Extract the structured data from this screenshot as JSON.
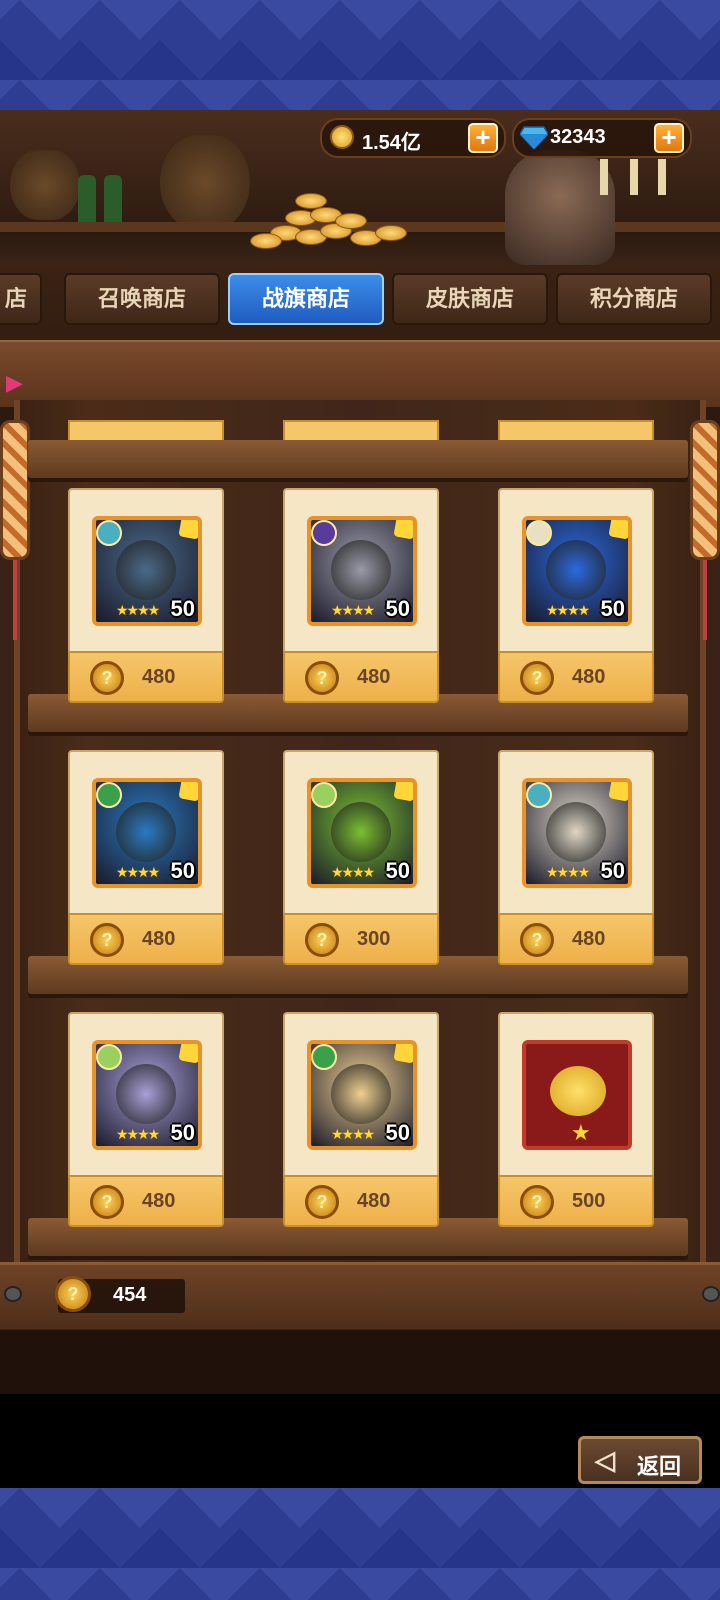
{
  "resources": {
    "gold": {
      "value": "1.54亿",
      "icon": "gold-coin-icon"
    },
    "gems": {
      "value": "32343",
      "icon": "diamond-icon"
    },
    "add_symbol": "+"
  },
  "tabs": [
    {
      "label": "店",
      "active": false
    },
    {
      "label": "召唤商店",
      "active": false
    },
    {
      "label": "战旗商店",
      "active": true
    },
    {
      "label": "皮肤商店",
      "active": false
    },
    {
      "label": "积分商店",
      "active": false
    }
  ],
  "items": [
    {
      "level": "50",
      "stars": "★★★★",
      "price": "480",
      "faction_color": "#4ab0c0",
      "hero_color": "#4a6a8a"
    },
    {
      "level": "50",
      "stars": "★★★★",
      "price": "480",
      "faction_color": "#5a3a9a",
      "hero_color": "#9a9aa8"
    },
    {
      "level": "50",
      "stars": "★★★★",
      "price": "480",
      "faction_color": "#e8e0c0",
      "hero_color": "#2a6ae0"
    },
    {
      "level": "50",
      "stars": "★★★★",
      "price": "480",
      "faction_color": "#3aa04a",
      "hero_color": "#2a7ac0"
    },
    {
      "level": "50",
      "stars": "★★★★",
      "price": "300",
      "faction_color": "#9ad060",
      "hero_color": "#7ac030"
    },
    {
      "level": "50",
      "stars": "★★★★",
      "price": "480",
      "faction_color": "#4ab0c0",
      "hero_color": "#e0d8c8"
    },
    {
      "level": "50",
      "stars": "★★★★",
      "price": "480",
      "faction_color": "#9ad060",
      "hero_color": "#a8a0d8"
    },
    {
      "level": "50",
      "stars": "★★★★",
      "price": "480",
      "faction_color": "#3aa04a",
      "hero_color": "#f0d090"
    },
    {
      "price": "500",
      "icon": "golden-pig-icon"
    }
  ],
  "currency_icon_glyph": "?",
  "balance": {
    "value": "454"
  },
  "back_button": {
    "label": "返回",
    "arrow": "◁"
  }
}
